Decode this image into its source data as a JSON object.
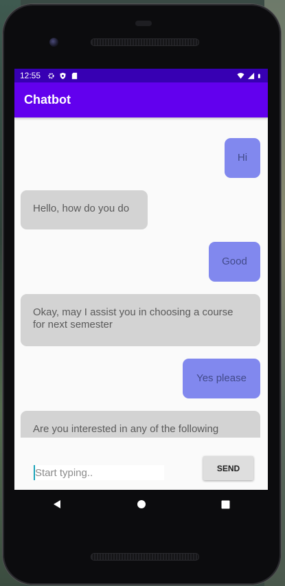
{
  "status_bar": {
    "time": "12:55",
    "left_icons": [
      "gear-icon",
      "shield-icon",
      "sd-card-icon"
    ],
    "right_icons": [
      "wifi-icon",
      "signal-icon",
      "battery-icon"
    ]
  },
  "app_bar": {
    "title": "Chatbot"
  },
  "messages": [
    {
      "sender": "user",
      "text": "Hi"
    },
    {
      "sender": "bot",
      "text": "Hello, how do you do"
    },
    {
      "sender": "user",
      "text": "Good"
    },
    {
      "sender": "bot",
      "text": "Okay, may I assist you in choosing a course for next semester"
    },
    {
      "sender": "user",
      "text": "Yes please"
    },
    {
      "sender": "bot",
      "text": "Are you interested in any of the following"
    }
  ],
  "composer": {
    "placeholder": "Start typing..",
    "value": "",
    "send_label": "SEND"
  },
  "nav_bar": {
    "icons": [
      "back-icon",
      "home-icon",
      "recents-icon"
    ]
  },
  "colors": {
    "status_bar": "#3700b3",
    "app_bar": "#6200ee",
    "user_bubble": "#8188ee",
    "bot_bubble": "#d3d3d3"
  }
}
